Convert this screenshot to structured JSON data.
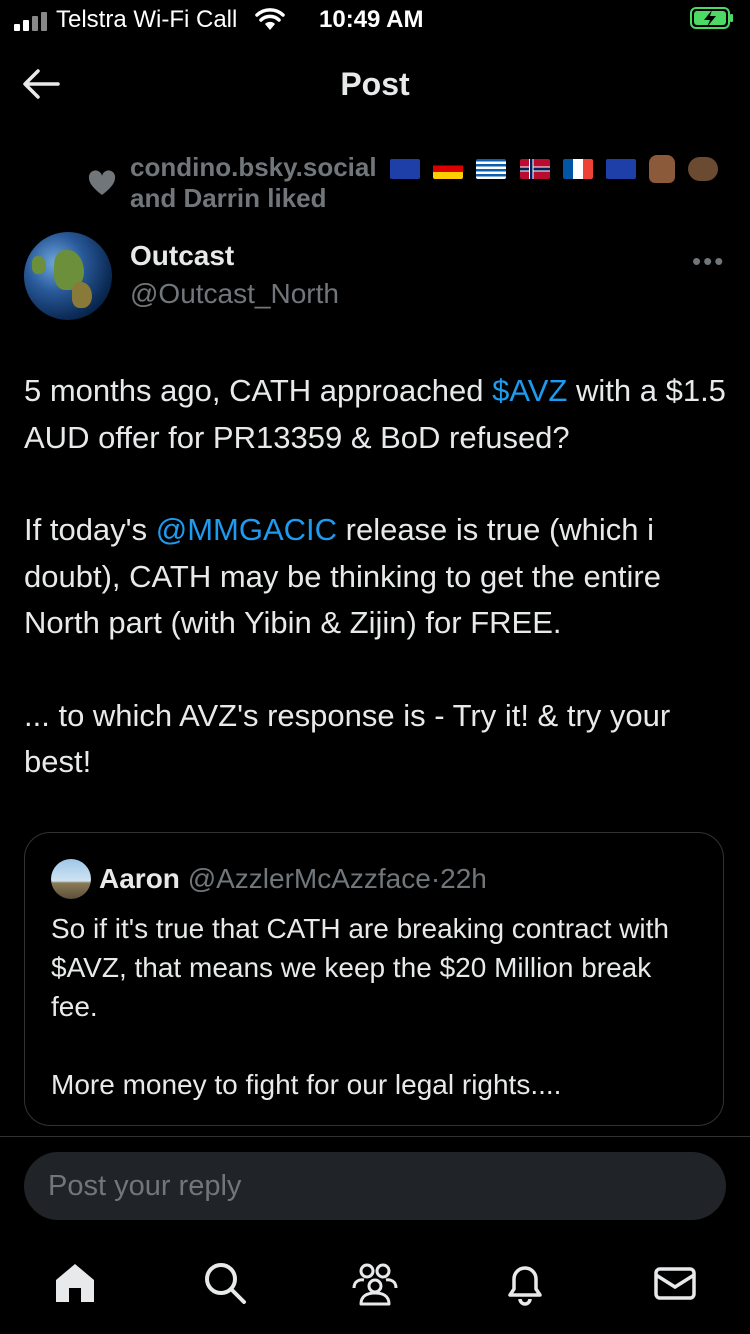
{
  "status_bar": {
    "carrier": "Telstra Wi-Fi Call",
    "time": "10:49 AM"
  },
  "header": {
    "title": "Post"
  },
  "social_context": {
    "line1": "condino.bsky.social",
    "line2": "and Darrin liked"
  },
  "post": {
    "author_name": "Outcast",
    "author_handle": "@Outcast_North",
    "p1a": "5 months ago, CATH approached ",
    "p1_link": "$AVZ",
    "p1b": " with a $1.5 AUD offer for PR13359 & BoD refused?",
    "p2a": "If today's ",
    "p2_link": "@MMGACIC",
    "p2b": " release is true (which i doubt), CATH may be thinking to get the entire North part (with Yibin & Zijin) for FREE.",
    "p3": "... to which AVZ's response is - Try it! & try your best!"
  },
  "quote": {
    "author_name": "Aaron",
    "author_handle": "@AzzlerMcAzzface",
    "separator": "·",
    "time": "22h",
    "p1": "So if it's true that CATH are breaking contract with $AVZ, that means we keep the $20 Million break fee.",
    "p2": "More money to fight for our legal rights...."
  },
  "reply": {
    "placeholder": "Post your reply"
  },
  "colors": {
    "link": "#1d9bf0",
    "muted": "#71767b",
    "text": "#e7e9ea",
    "battery": "#4cd964"
  },
  "icons": {
    "back": "arrow-left-icon",
    "heart": "heart-icon",
    "more": "more-horizontal-icon",
    "home": "home-icon",
    "search": "search-icon",
    "communities": "communities-icon",
    "notifications": "bell-icon",
    "messages": "mail-icon"
  }
}
